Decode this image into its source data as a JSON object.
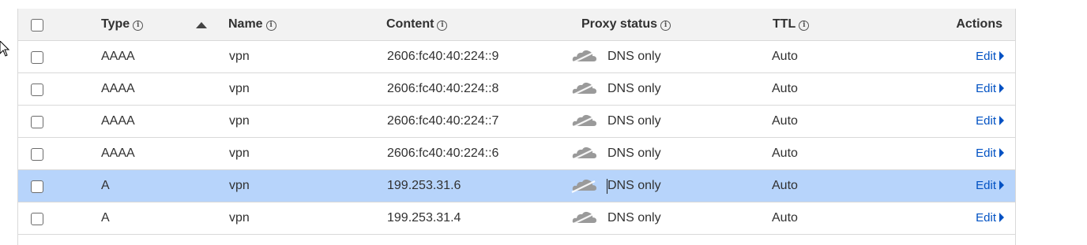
{
  "header": {
    "type_label": "Type",
    "name_label": "Name",
    "content_label": "Content",
    "proxy_label": "Proxy status",
    "ttl_label": "TTL",
    "actions_label": "Actions",
    "info_glyph": "i"
  },
  "rows": [
    {
      "type": "AAAA",
      "name": "vpn",
      "content": "2606:fc40:40:224::9",
      "proxy": "DNS only",
      "ttl": "Auto",
      "action": "Edit"
    },
    {
      "type": "AAAA",
      "name": "vpn",
      "content": "2606:fc40:40:224::8",
      "proxy": "DNS only",
      "ttl": "Auto",
      "action": "Edit"
    },
    {
      "type": "AAAA",
      "name": "vpn",
      "content": "2606:fc40:40:224::7",
      "proxy": "DNS only",
      "ttl": "Auto",
      "action": "Edit"
    },
    {
      "type": "AAAA",
      "name": "vpn",
      "content": "2606:fc40:40:224::6",
      "proxy": "DNS only",
      "ttl": "Auto",
      "action": "Edit"
    },
    {
      "type": "A",
      "name": "vpn",
      "content": "199.253.31.6",
      "proxy": "DNS only",
      "ttl": "Auto",
      "action": "Edit"
    },
    {
      "type": "A",
      "name": "vpn",
      "content": "199.253.31.4",
      "proxy": "DNS only",
      "ttl": "Auto",
      "action": "Edit"
    }
  ],
  "selected_row_index": 4,
  "colors": {
    "selected_row": "#b7d4fb",
    "link": "#0051c3",
    "header_bg": "#f2f2f2",
    "cloud": "#9a9a9a"
  },
  "icons": {
    "proxy": "cloud-icon",
    "sort": "sort-ascending-icon",
    "info": "info-icon",
    "edit": "caret-right-icon"
  }
}
